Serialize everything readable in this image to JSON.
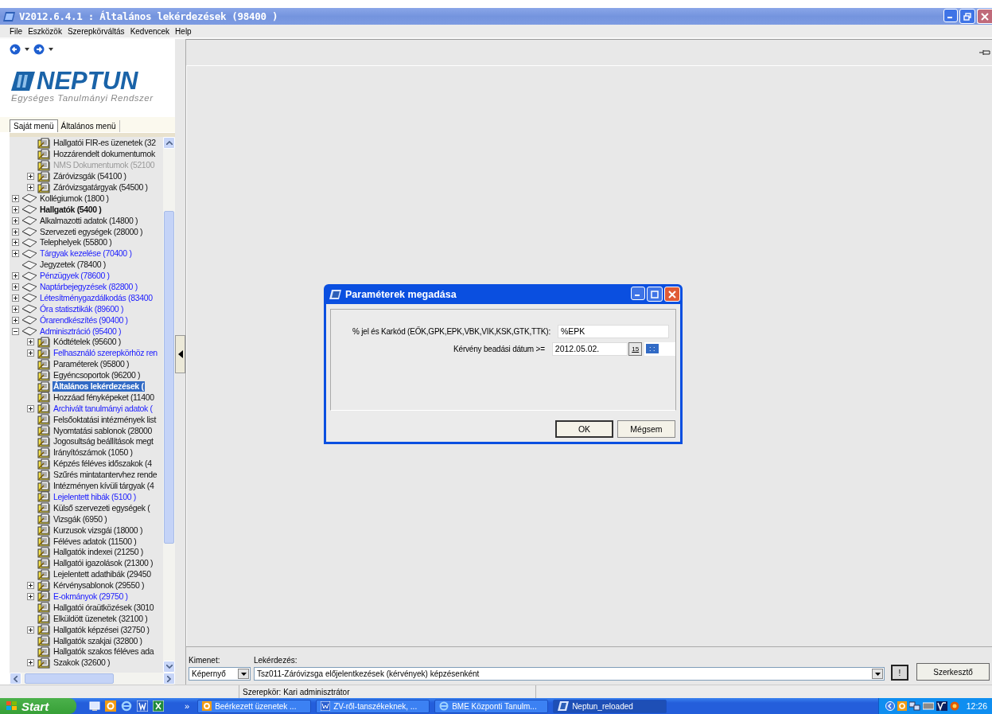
{
  "window": {
    "title": "V2012.6.4.1 : Általános lekérdezések (98400 )"
  },
  "menu": [
    "File",
    "Eszközök",
    "Szerepkörváltás",
    "Kedvencek",
    "Help"
  ],
  "logo": {
    "name": "NEPTUN",
    "subtitle": "Egységes Tanulmányi Rendszer"
  },
  "tabs": [
    {
      "label": "Saját menü",
      "selected": true
    },
    {
      "label": "Általános menü",
      "selected": false
    }
  ],
  "tree": {
    "items": [
      {
        "children": [
          {
            "label": "Hallgatói FIR-es üzenetek (32",
            "kind": "report",
            "link": false,
            "disabled": false,
            "bold": false,
            "selected": false
          },
          {
            "label": "Hozzárendelt dokumentumok",
            "kind": "report",
            "link": false,
            "disabled": false,
            "bold": false,
            "selected": false
          },
          {
            "label": "NMS Dokumentumok (52100",
            "kind": "report",
            "link": false,
            "disabled": true,
            "bold": false,
            "selected": false
          },
          {
            "label": "Záróvizsgák (54100 )",
            "kind": "report",
            "link": false,
            "disabled": false,
            "bold": false,
            "selected": false,
            "expanded": false
          },
          {
            "label": "Záróvizsgatárgyak (54500 )",
            "kind": "report",
            "link": false,
            "disabled": false,
            "bold": false,
            "selected": false,
            "expanded": false
          }
        ]
      },
      {
        "label": "Kollégiumok (1800 )",
        "kind": "folder",
        "link": false,
        "disabled": false,
        "bold": false,
        "selected": false,
        "expanded": false
      },
      {
        "label": "Hallgatók (5400 )",
        "kind": "folder",
        "link": false,
        "disabled": false,
        "bold": true,
        "selected": false,
        "expanded": false
      },
      {
        "label": "Alkalmazotti adatok (14800 )",
        "kind": "folder",
        "link": false,
        "disabled": false,
        "bold": false,
        "selected": false,
        "expanded": false
      },
      {
        "label": "Szervezeti egységek (28000 )",
        "kind": "folder",
        "link": false,
        "disabled": false,
        "bold": false,
        "selected": false,
        "expanded": false
      },
      {
        "label": "Telephelyek (55800 )",
        "kind": "folder",
        "link": false,
        "disabled": false,
        "bold": false,
        "selected": false,
        "expanded": false
      },
      {
        "label": "Tárgyak kezelése (70400 )",
        "kind": "folder",
        "link": true,
        "disabled": false,
        "bold": false,
        "selected": false,
        "expanded": false
      },
      {
        "label": "Jegyzetek (78400 )",
        "kind": "folder",
        "link": false,
        "disabled": false,
        "bold": false,
        "selected": false
      },
      {
        "label": "Pénzügyek (78600 )",
        "kind": "folder",
        "link": true,
        "disabled": false,
        "bold": false,
        "selected": false,
        "expanded": false
      },
      {
        "label": "Naptárbejegyzések (82800 )",
        "kind": "folder",
        "link": true,
        "disabled": false,
        "bold": false,
        "selected": false,
        "expanded": false
      },
      {
        "label": "Létesítménygazdálkodás (83400",
        "kind": "folder",
        "link": true,
        "disabled": false,
        "bold": false,
        "selected": false,
        "expanded": false
      },
      {
        "label": "Óra statisztikák (89600 )",
        "kind": "folder",
        "link": true,
        "disabled": false,
        "bold": false,
        "selected": false,
        "expanded": false
      },
      {
        "label": "Órarendkészítés (90400 )",
        "kind": "folder",
        "link": true,
        "disabled": false,
        "bold": false,
        "selected": false,
        "expanded": false
      },
      {
        "label": "Adminisztráció (95400 )",
        "kind": "folder",
        "link": true,
        "disabled": false,
        "bold": false,
        "selected": false,
        "expanded": true,
        "children": [
          {
            "label": "Kódtételek (95600 )",
            "kind": "report",
            "link": false,
            "disabled": false,
            "bold": false,
            "selected": false,
            "expanded": false
          },
          {
            "label": "Felhasználó szerepkörhöz ren",
            "kind": "report",
            "link": true,
            "disabled": false,
            "bold": false,
            "selected": false,
            "expanded": false
          },
          {
            "label": "Paraméterek (95800 )",
            "kind": "report",
            "link": false,
            "disabled": false,
            "bold": false,
            "selected": false
          },
          {
            "label": "Egyéncsoportok (96200 )",
            "kind": "report",
            "link": false,
            "disabled": false,
            "bold": false,
            "selected": false
          },
          {
            "label": "Általános lekérdezések (",
            "kind": "report",
            "link": false,
            "disabled": false,
            "bold": true,
            "selected": true
          },
          {
            "label": "Hozzáad fényképeket (11400",
            "kind": "report",
            "link": false,
            "disabled": false,
            "bold": false,
            "selected": false
          },
          {
            "label": "Archivált tanulmányi adatok (",
            "kind": "report",
            "link": true,
            "disabled": false,
            "bold": false,
            "selected": false,
            "expanded": false
          },
          {
            "label": "Felsőoktatási intézmények list",
            "kind": "report",
            "link": false,
            "disabled": false,
            "bold": false,
            "selected": false
          },
          {
            "label": "Nyomtatási sablonok (28000",
            "kind": "report",
            "link": false,
            "disabled": false,
            "bold": false,
            "selected": false
          },
          {
            "label": "Jogosultság beállítások megt",
            "kind": "report",
            "link": false,
            "disabled": false,
            "bold": false,
            "selected": false
          },
          {
            "label": "Irányítószámok (1050 )",
            "kind": "report",
            "link": false,
            "disabled": false,
            "bold": false,
            "selected": false
          },
          {
            "label": "Képzés féléves időszakok (4",
            "kind": "report",
            "link": false,
            "disabled": false,
            "bold": false,
            "selected": false
          },
          {
            "label": "Szűrés mintatantervhez rende",
            "kind": "report",
            "link": false,
            "disabled": false,
            "bold": false,
            "selected": false
          },
          {
            "label": "Intézményen kívüli tárgyak (4",
            "kind": "report",
            "link": false,
            "disabled": false,
            "bold": false,
            "selected": false
          },
          {
            "label": "Lejelentett hibák (5100 )",
            "kind": "report",
            "link": true,
            "disabled": false,
            "bold": false,
            "selected": false
          },
          {
            "label": "Külső szervezeti egységek (",
            "kind": "report",
            "link": false,
            "disabled": false,
            "bold": false,
            "selected": false
          },
          {
            "label": "Vizsgák (6950 )",
            "kind": "report",
            "link": false,
            "disabled": false,
            "bold": false,
            "selected": false
          },
          {
            "label": "Kurzusok vizsgái (18000 )",
            "kind": "report",
            "link": false,
            "disabled": false,
            "bold": false,
            "selected": false
          },
          {
            "label": "Féléves adatok (11500 )",
            "kind": "report",
            "link": false,
            "disabled": false,
            "bold": false,
            "selected": false
          },
          {
            "label": "Hallgatók indexei (21250 )",
            "kind": "report",
            "link": false,
            "disabled": false,
            "bold": false,
            "selected": false
          },
          {
            "label": "Hallgatói igazolások (21300 )",
            "kind": "report",
            "link": false,
            "disabled": false,
            "bold": false,
            "selected": false
          },
          {
            "label": "Lejelentett adathibák (29450",
            "kind": "report",
            "link": false,
            "disabled": false,
            "bold": false,
            "selected": false
          },
          {
            "label": "Kérvénysablonok (29550 )",
            "kind": "report",
            "link": false,
            "disabled": false,
            "bold": false,
            "selected": false,
            "expanded": false
          },
          {
            "label": "E-okmányok (29750 )",
            "kind": "report",
            "link": true,
            "disabled": false,
            "bold": false,
            "selected": false,
            "expanded": false
          },
          {
            "label": "Hallgatói óraütközések (3010",
            "kind": "report",
            "link": false,
            "disabled": false,
            "bold": false,
            "selected": false
          },
          {
            "label": "Elküldött üzenetek (32100 )",
            "kind": "report",
            "link": false,
            "disabled": false,
            "bold": false,
            "selected": false
          },
          {
            "label": "Hallgatók képzései (32750 )",
            "kind": "report",
            "link": false,
            "disabled": false,
            "bold": false,
            "selected": false,
            "expanded": false
          },
          {
            "label": "Hallgatók szakjai (32800 )",
            "kind": "report",
            "link": false,
            "disabled": false,
            "bold": false,
            "selected": false
          },
          {
            "label": "Hallgatók szakos féléves ada",
            "kind": "report",
            "link": false,
            "disabled": false,
            "bold": false,
            "selected": false
          },
          {
            "label": "Szakok (32600 )",
            "kind": "report",
            "link": false,
            "disabled": false,
            "bold": false,
            "selected": false,
            "expanded": false
          }
        ]
      }
    ]
  },
  "dialog": {
    "title": "Paraméterek megadása",
    "fields": [
      {
        "kind": "text",
        "label": "% jel és Karkód (EŐK,GPK,EPK,VBK,VIK,KSK,GTK,TTK):",
        "value": "%EPK"
      },
      {
        "kind": "date",
        "label": "Kérvény beadási dátum >=",
        "value": "2012.05.02.",
        "calendar": "15",
        "time": ": :"
      }
    ],
    "buttons": [
      {
        "label": "OK",
        "default": true
      },
      {
        "label": "Mégsem",
        "default": false
      }
    ]
  },
  "query_bar": {
    "output_label": "Kimenet:",
    "output_value": "Képernyő",
    "query_label": "Lekérdezés:",
    "query_value": "Tsz011-Záróvizsga előjelentkezések (kérvények) képzésenként",
    "run_button": "!",
    "editor_button": "Szerkesztő"
  },
  "status_bar": {
    "role": "Szerepkör: Kari adminisztrátor"
  },
  "taskbar": {
    "start": "Start",
    "overflow": "»",
    "tasks": [
      {
        "label": "Beérkezett üzenetek ...",
        "kind": "mail",
        "selected": false
      },
      {
        "label": "ZV-ről-tanszékeknek, ...",
        "kind": "word",
        "selected": false
      },
      {
        "label": "BME Központi Tanulm...",
        "kind": "browser",
        "selected": false
      },
      {
        "label": "Neptun_reloaded",
        "kind": "neptun",
        "selected": true
      }
    ],
    "clock": "12:26"
  }
}
